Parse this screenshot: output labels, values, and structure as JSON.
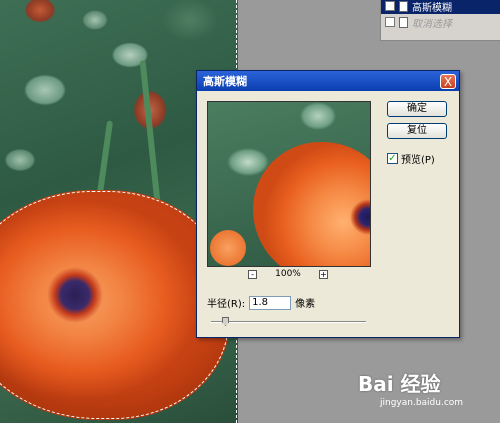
{
  "history": {
    "items": [
      {
        "label": "高斯模糊"
      },
      {
        "label": "取消选择"
      }
    ]
  },
  "dialog": {
    "title": "高斯模糊",
    "close_glyph": "X",
    "ok_label": "确定",
    "reset_label": "复位",
    "preview_label": "预览(P)",
    "preview_checked": true,
    "zoom": "100%",
    "zoom_out": "-",
    "zoom_in": "+",
    "radius_label": "半径(R):",
    "radius_value": "1.8",
    "radius_unit": "像素"
  },
  "watermark": {
    "brand": "Bai 经验",
    "url": "jingyan.baidu.com"
  }
}
